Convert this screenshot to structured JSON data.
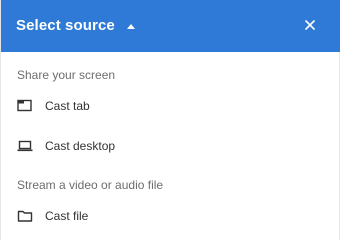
{
  "header": {
    "title": "Select source",
    "caret_icon": "caret-up-icon",
    "close_icon": "close-icon",
    "background_color": "#2f7ad6"
  },
  "sections": [
    {
      "label": "Share your screen",
      "items": [
        {
          "label": "Cast tab",
          "icon": "tab-icon"
        },
        {
          "label": "Cast desktop",
          "icon": "laptop-icon"
        }
      ]
    },
    {
      "label": "Stream a video or audio file",
      "items": [
        {
          "label": "Cast file",
          "icon": "folder-icon"
        }
      ]
    }
  ]
}
